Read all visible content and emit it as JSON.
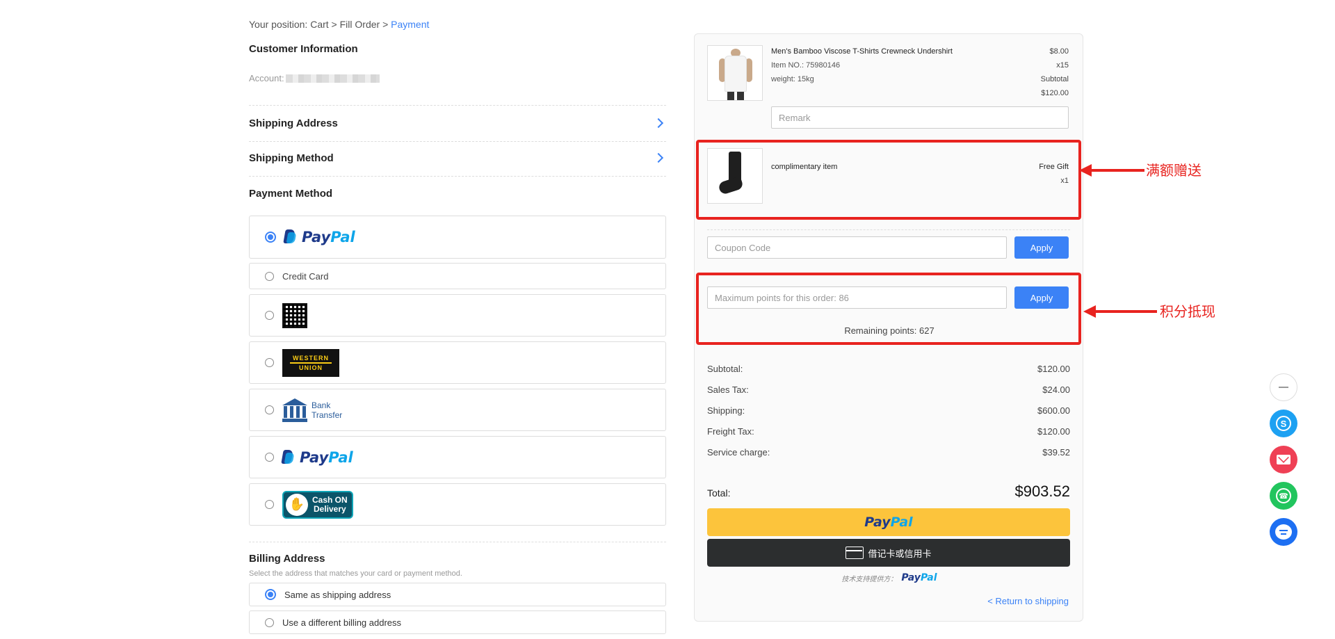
{
  "breadcrumb": {
    "prefix": "Your position: Cart > Fill Order > ",
    "current": "Payment"
  },
  "customer": {
    "title": "Customer Information",
    "account_label": "Account:"
  },
  "shipping_address": {
    "label": "Shipping Address"
  },
  "shipping_method": {
    "label": "Shipping Method"
  },
  "payment_method": {
    "title": "Payment Method",
    "options": [
      {
        "name": "paypal",
        "logo_text_1": "Pay",
        "logo_text_2": "Pal",
        "selected": true
      },
      {
        "name": "credit-card",
        "label": "Credit Card",
        "selected": false
      },
      {
        "name": "qr-code",
        "selected": false
      },
      {
        "name": "western-union",
        "logo_line_1": "WESTERN",
        "logo_line_2": "UNION",
        "selected": false
      },
      {
        "name": "bank-transfer",
        "logo_line_1": "Bank",
        "logo_line_2": "Transfer",
        "selected": false
      },
      {
        "name": "paypal-2",
        "logo_text_1": "Pay",
        "logo_text_2": "Pal",
        "selected": false
      },
      {
        "name": "cash-on-delivery",
        "logo_line_1": "Cash ON",
        "logo_line_2": "Delivery",
        "selected": false
      }
    ]
  },
  "billing": {
    "title": "Billing Address",
    "subtitle": "Select the address that matches your card or payment method.",
    "options": [
      {
        "label": "Same as shipping address",
        "selected": true
      },
      {
        "label": "Use a different billing address",
        "selected": false
      }
    ]
  },
  "order": {
    "product": {
      "name": "Men's Bamboo Viscose T-Shirts Crewneck Undershirt",
      "item_no": "Item NO.: 75980146",
      "weight": "weight: 15kg",
      "price": "$8.00",
      "qty": "x15",
      "subtotal_label": "Subtotal",
      "subtotal": "$120.00"
    },
    "remark_placeholder": "Remark",
    "gift": {
      "name": "complimentary item",
      "label": "Free Gift",
      "qty": "x1"
    },
    "coupon": {
      "placeholder": "Coupon Code",
      "button": "Apply"
    },
    "points": {
      "placeholder": "Maximum points for this order: 86",
      "button": "Apply",
      "remaining": "Remaining points: 627"
    },
    "summary": [
      {
        "label": "Subtotal:",
        "value": "$120.00"
      },
      {
        "label": "Sales Tax:",
        "value": "$24.00"
      },
      {
        "label": "Shipping:",
        "value": "$600.00"
      },
      {
        "label": "Freight Tax:",
        "value": "$120.00"
      },
      {
        "label": "Service charge:",
        "value": "$39.52"
      }
    ],
    "total_label": "Total:",
    "total_value": "$903.52",
    "paypal_button": {
      "text_1": "Pay",
      "text_2": "Pal"
    },
    "card_button": "借记卡或信用卡",
    "powered_by": "技术支持提供方：",
    "powered_logo": {
      "text_1": "Pay",
      "text_2": "Pal"
    },
    "return_link": "< Return to shipping"
  },
  "annotations": {
    "gift": "满额赠送",
    "points": "积分抵现"
  },
  "colors": {
    "accent": "#3b82f6",
    "annotation": "#e8231f",
    "paypal_yellow": "#fcc43c"
  },
  "floating_icons": [
    "minimize-icon",
    "skype-icon",
    "mail-icon",
    "whatsapp-icon",
    "chat-icon"
  ]
}
